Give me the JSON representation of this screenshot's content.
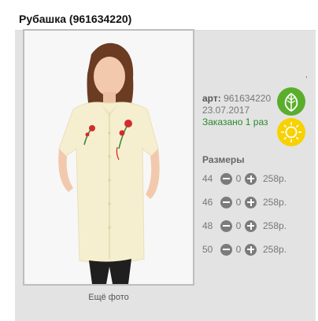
{
  "product": {
    "title": "Рубашка (961634220)",
    "more_photos_label": "Ещё фото",
    "dot_mark": ",",
    "sku_label": "арт:",
    "sku_value": "961634220",
    "date": "23.07.2017",
    "ordered_text": "Заказано 1 раз"
  },
  "icons": {
    "leaf": "leaf-icon",
    "sun": "sun-icon",
    "minus": "minus-icon",
    "plus": "plus-icon"
  },
  "sizes": {
    "title": "Размеры",
    "rows": [
      {
        "size": "44",
        "qty": "0",
        "price": "258р."
      },
      {
        "size": "46",
        "qty": "0",
        "price": "258р."
      },
      {
        "size": "48",
        "qty": "0",
        "price": "258р."
      },
      {
        "size": "50",
        "qty": "0",
        "price": "258р."
      }
    ]
  },
  "colors": {
    "card_bg": "#e3e3e3",
    "leaf_green": "#5aae2c",
    "sun_yellow": "#f7d100",
    "ordered_green": "#2a8a2a",
    "button_grey": "#7b7b7b"
  }
}
